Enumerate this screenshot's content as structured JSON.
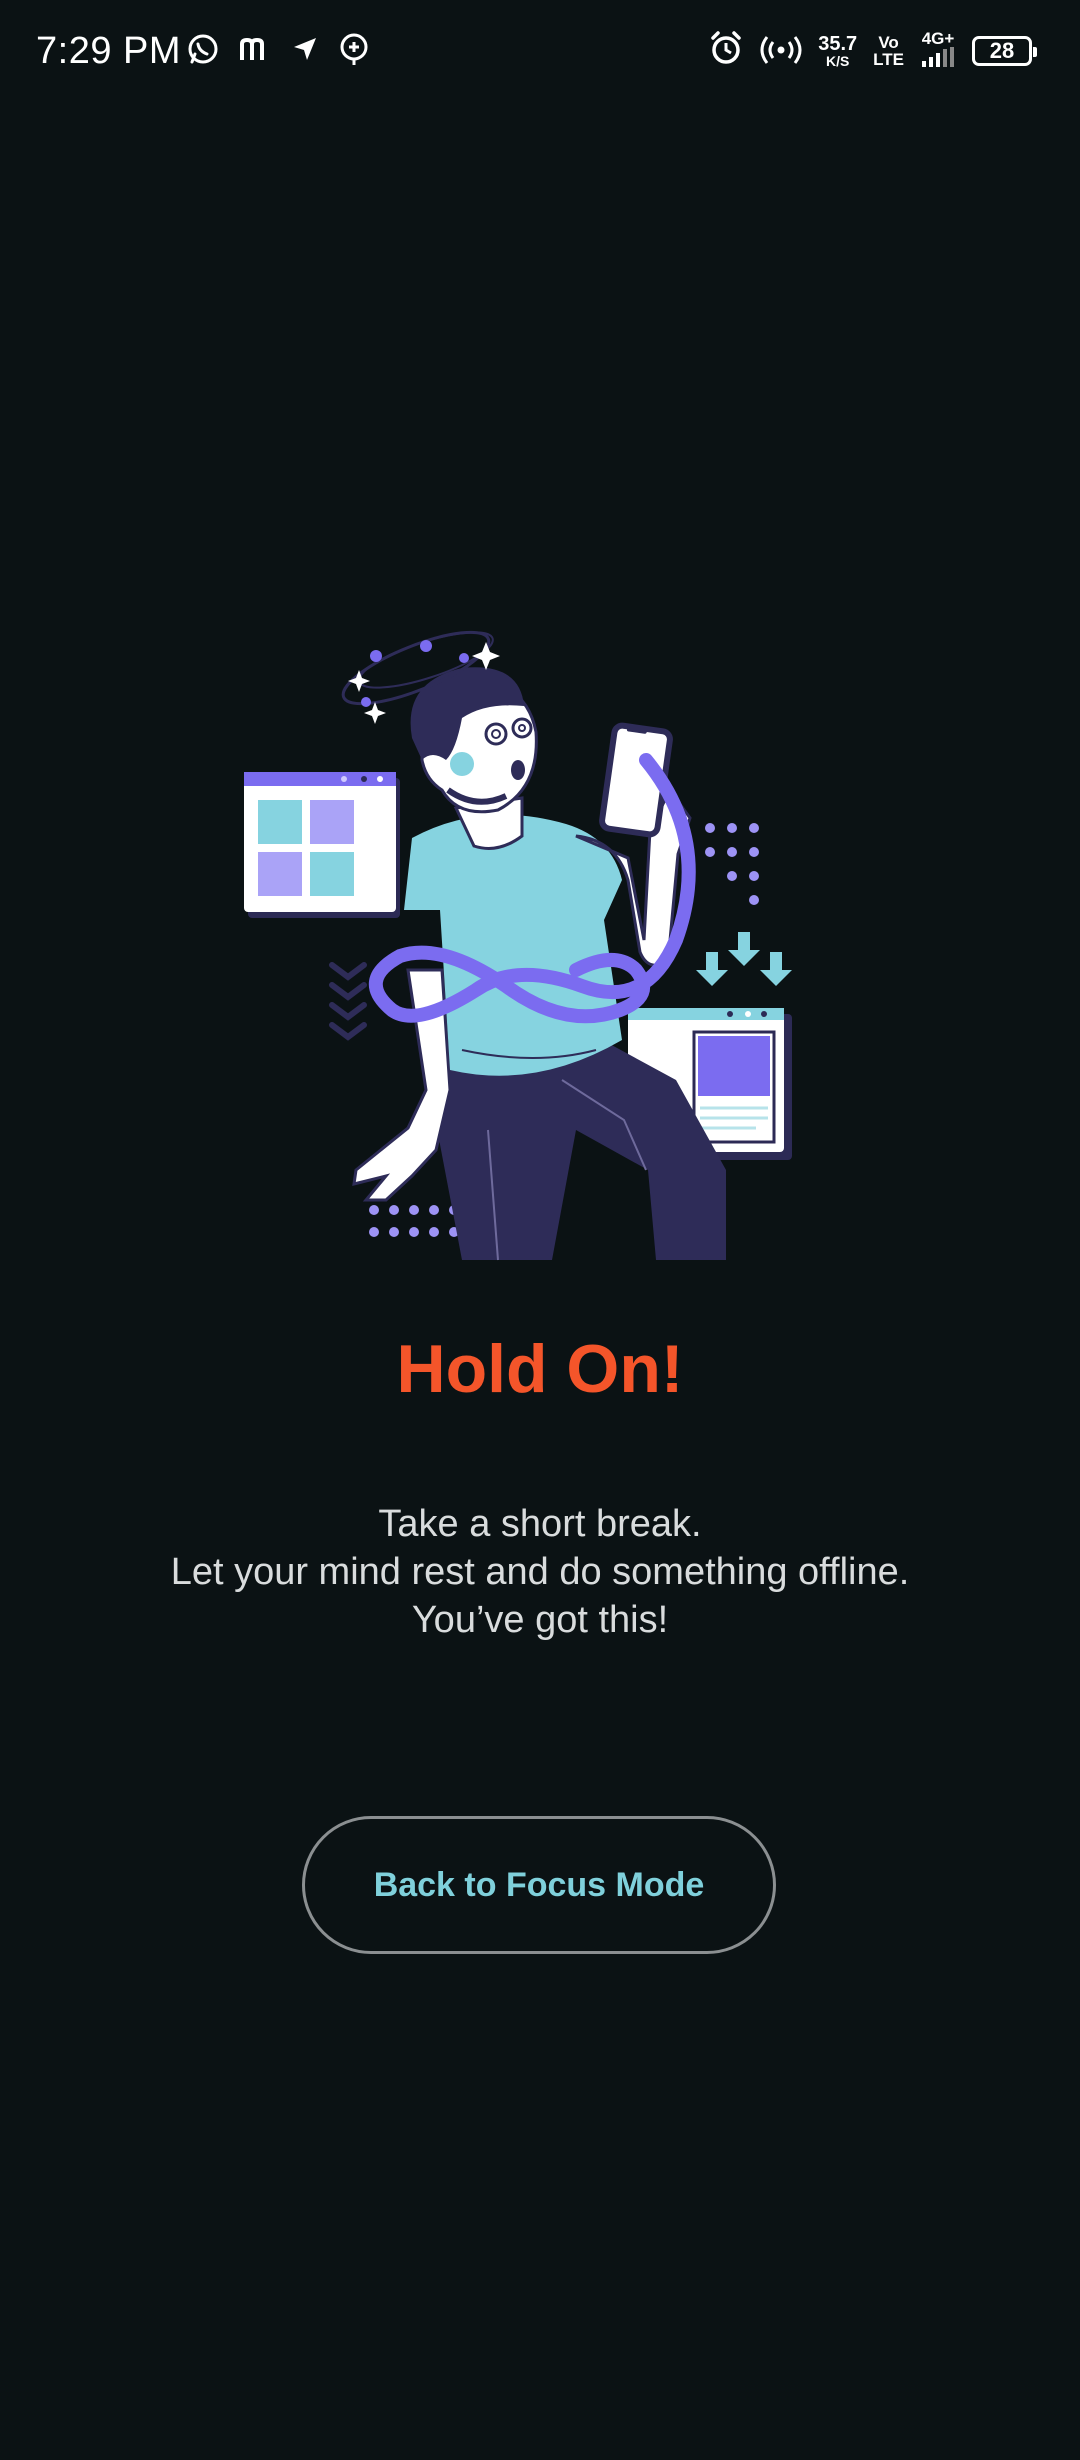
{
  "status_bar": {
    "time": "7:29 PM",
    "net_speed_value": "35.7",
    "net_speed_unit": "K/S",
    "volte_top": "Vo",
    "volte_bottom": "LTE",
    "network_type": "4G+",
    "battery_level": "28",
    "left_icons": [
      "whatsapp-icon",
      "m-app-icon",
      "navigation-icon",
      "chat-add-icon"
    ],
    "right_icons": [
      "alarm-icon",
      "hotspot-icon",
      "signal-icon",
      "battery-icon"
    ]
  },
  "illustration": {
    "description_icon": "distracted-person-with-phone-illustration"
  },
  "screen": {
    "title": "Hold On!",
    "message_lines": [
      "Take a short break.",
      "Let your mind rest and do something offline.",
      "You’ve got this!"
    ],
    "button_label": "Back to Focus Mode"
  },
  "colors": {
    "background": "#0b1214",
    "title": "#f4552a",
    "button_text": "#7fd0db",
    "button_border": "#8b8f91",
    "accent_purple": "#7b6cf0",
    "accent_teal": "#86d3e0"
  }
}
